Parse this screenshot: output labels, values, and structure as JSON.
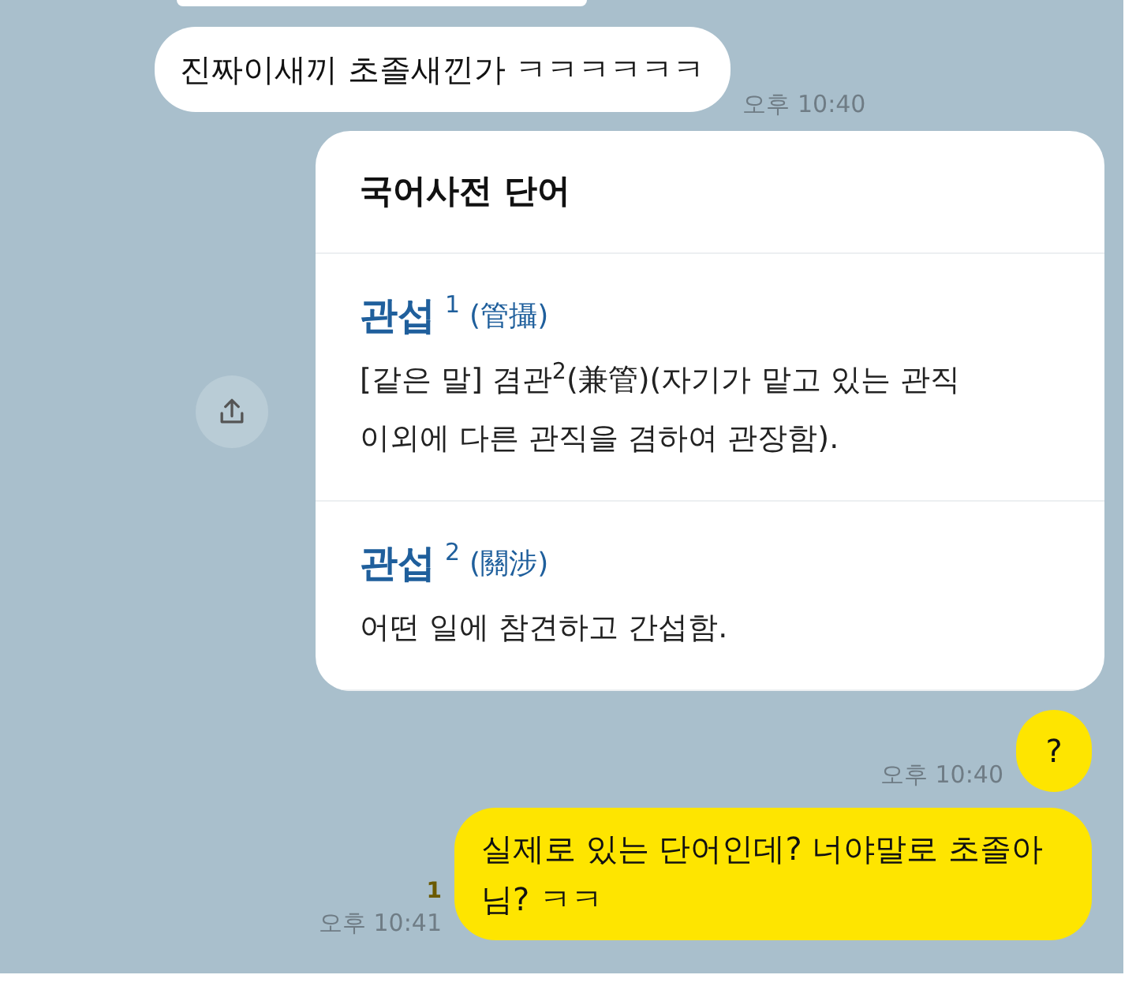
{
  "messages": [
    {
      "kind": "cut"
    },
    {
      "kind": "incoming",
      "text": "진짜이새끼 초졸새낀가 ㅋㅋㅋㅋㅋㅋ",
      "time": "오후 10:40"
    },
    {
      "kind": "dictionary",
      "title": "국어사전 단어",
      "entries": [
        {
          "word": "관섭",
          "number": "1",
          "hanja": "(管攝)",
          "definition": "[같은 말] 겸관$^{2}$(兼管)(자기가 맡고 있는 관직 이외에 다른 관직을 겸하여 관장함)."
        },
        {
          "word": "관섭",
          "number": "2",
          "hanja": "(關涉)",
          "definition": "어떤 일에 참견하고 간섭함."
        }
      ]
    },
    {
      "kind": "outgoing",
      "text": "?",
      "time": "오후 10:40"
    },
    {
      "kind": "outgoing",
      "text": "실제로 있는 단어인데? 너야말로 초졸아님? ㅋㅋ",
      "time": "오후 10:41",
      "unread": "1"
    }
  ]
}
